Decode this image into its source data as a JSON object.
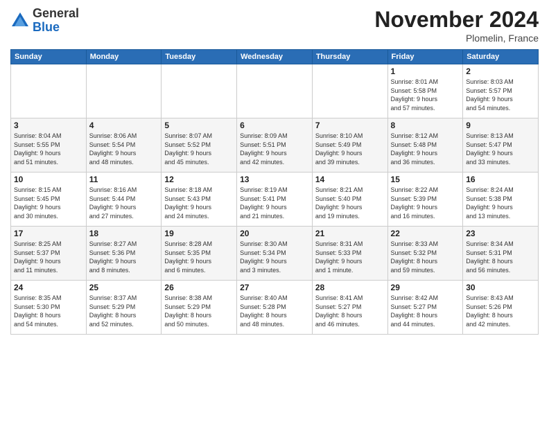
{
  "logo": {
    "general": "General",
    "blue": "Blue"
  },
  "title": "November 2024",
  "location": "Plomelin, France",
  "days_header": [
    "Sunday",
    "Monday",
    "Tuesday",
    "Wednesday",
    "Thursday",
    "Friday",
    "Saturday"
  ],
  "weeks": [
    [
      {
        "day": "",
        "info": ""
      },
      {
        "day": "",
        "info": ""
      },
      {
        "day": "",
        "info": ""
      },
      {
        "day": "",
        "info": ""
      },
      {
        "day": "",
        "info": ""
      },
      {
        "day": "1",
        "info": "Sunrise: 8:01 AM\nSunset: 5:58 PM\nDaylight: 9 hours\nand 57 minutes."
      },
      {
        "day": "2",
        "info": "Sunrise: 8:03 AM\nSunset: 5:57 PM\nDaylight: 9 hours\nand 54 minutes."
      }
    ],
    [
      {
        "day": "3",
        "info": "Sunrise: 8:04 AM\nSunset: 5:55 PM\nDaylight: 9 hours\nand 51 minutes."
      },
      {
        "day": "4",
        "info": "Sunrise: 8:06 AM\nSunset: 5:54 PM\nDaylight: 9 hours\nand 48 minutes."
      },
      {
        "day": "5",
        "info": "Sunrise: 8:07 AM\nSunset: 5:52 PM\nDaylight: 9 hours\nand 45 minutes."
      },
      {
        "day": "6",
        "info": "Sunrise: 8:09 AM\nSunset: 5:51 PM\nDaylight: 9 hours\nand 42 minutes."
      },
      {
        "day": "7",
        "info": "Sunrise: 8:10 AM\nSunset: 5:49 PM\nDaylight: 9 hours\nand 39 minutes."
      },
      {
        "day": "8",
        "info": "Sunrise: 8:12 AM\nSunset: 5:48 PM\nDaylight: 9 hours\nand 36 minutes."
      },
      {
        "day": "9",
        "info": "Sunrise: 8:13 AM\nSunset: 5:47 PM\nDaylight: 9 hours\nand 33 minutes."
      }
    ],
    [
      {
        "day": "10",
        "info": "Sunrise: 8:15 AM\nSunset: 5:45 PM\nDaylight: 9 hours\nand 30 minutes."
      },
      {
        "day": "11",
        "info": "Sunrise: 8:16 AM\nSunset: 5:44 PM\nDaylight: 9 hours\nand 27 minutes."
      },
      {
        "day": "12",
        "info": "Sunrise: 8:18 AM\nSunset: 5:43 PM\nDaylight: 9 hours\nand 24 minutes."
      },
      {
        "day": "13",
        "info": "Sunrise: 8:19 AM\nSunset: 5:41 PM\nDaylight: 9 hours\nand 21 minutes."
      },
      {
        "day": "14",
        "info": "Sunrise: 8:21 AM\nSunset: 5:40 PM\nDaylight: 9 hours\nand 19 minutes."
      },
      {
        "day": "15",
        "info": "Sunrise: 8:22 AM\nSunset: 5:39 PM\nDaylight: 9 hours\nand 16 minutes."
      },
      {
        "day": "16",
        "info": "Sunrise: 8:24 AM\nSunset: 5:38 PM\nDaylight: 9 hours\nand 13 minutes."
      }
    ],
    [
      {
        "day": "17",
        "info": "Sunrise: 8:25 AM\nSunset: 5:37 PM\nDaylight: 9 hours\nand 11 minutes."
      },
      {
        "day": "18",
        "info": "Sunrise: 8:27 AM\nSunset: 5:36 PM\nDaylight: 9 hours\nand 8 minutes."
      },
      {
        "day": "19",
        "info": "Sunrise: 8:28 AM\nSunset: 5:35 PM\nDaylight: 9 hours\nand 6 minutes."
      },
      {
        "day": "20",
        "info": "Sunrise: 8:30 AM\nSunset: 5:34 PM\nDaylight: 9 hours\nand 3 minutes."
      },
      {
        "day": "21",
        "info": "Sunrise: 8:31 AM\nSunset: 5:33 PM\nDaylight: 9 hours\nand 1 minute."
      },
      {
        "day": "22",
        "info": "Sunrise: 8:33 AM\nSunset: 5:32 PM\nDaylight: 8 hours\nand 59 minutes."
      },
      {
        "day": "23",
        "info": "Sunrise: 8:34 AM\nSunset: 5:31 PM\nDaylight: 8 hours\nand 56 minutes."
      }
    ],
    [
      {
        "day": "24",
        "info": "Sunrise: 8:35 AM\nSunset: 5:30 PM\nDaylight: 8 hours\nand 54 minutes."
      },
      {
        "day": "25",
        "info": "Sunrise: 8:37 AM\nSunset: 5:29 PM\nDaylight: 8 hours\nand 52 minutes."
      },
      {
        "day": "26",
        "info": "Sunrise: 8:38 AM\nSunset: 5:29 PM\nDaylight: 8 hours\nand 50 minutes."
      },
      {
        "day": "27",
        "info": "Sunrise: 8:40 AM\nSunset: 5:28 PM\nDaylight: 8 hours\nand 48 minutes."
      },
      {
        "day": "28",
        "info": "Sunrise: 8:41 AM\nSunset: 5:27 PM\nDaylight: 8 hours\nand 46 minutes."
      },
      {
        "day": "29",
        "info": "Sunrise: 8:42 AM\nSunset: 5:27 PM\nDaylight: 8 hours\nand 44 minutes."
      },
      {
        "day": "30",
        "info": "Sunrise: 8:43 AM\nSunset: 5:26 PM\nDaylight: 8 hours\nand 42 minutes."
      }
    ]
  ]
}
